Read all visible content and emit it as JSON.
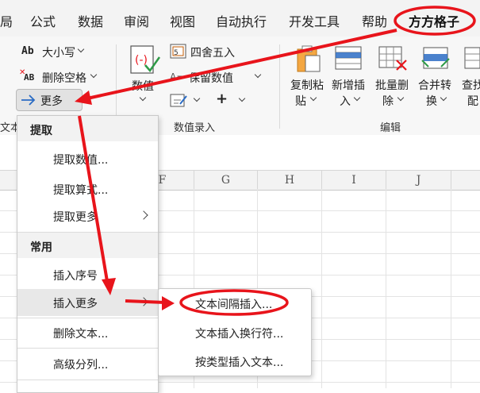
{
  "tabs": [
    "局",
    "公式",
    "数据",
    "审阅",
    "视图",
    "自动执行",
    "开发工具",
    "帮助",
    "方方格子"
  ],
  "ribbon": {
    "case_label": "大小写",
    "case_icon_text": "Ab",
    "delete_space_label": "删除空格",
    "delete_space_icon_text": "AB",
    "more_label": "更多",
    "text_group_label": "文本",
    "numeric_label": "数值",
    "round_label": "四舍五入",
    "keep_value_label": "保留数值",
    "keep_value_icon_text": "A=",
    "plus_label": "+",
    "numeric_group_label": "数值录入",
    "copy_paste_label_line1": "复制粘",
    "copy_paste_label_line2": "贴",
    "insert_label_line1": "新增插",
    "insert_label_line2": "入",
    "batch_delete_label_line1": "批量删",
    "batch_delete_label_line2": "除",
    "merge_label_line1": "合并转",
    "merge_label_line2": "换",
    "find_label_line1": "查找",
    "find_label_line2": "配",
    "edit_group_label": "编辑"
  },
  "columns": [
    "F",
    "G",
    "H",
    "I",
    "J"
  ],
  "menu": {
    "section_extract": "提取",
    "extract_items": [
      "提取数值...",
      "提取算式...",
      "提取更多"
    ],
    "section_common": "常用",
    "common_items": [
      "插入序号",
      "插入更多",
      "删除文本...",
      "高级分列..."
    ]
  },
  "submenu": {
    "items": [
      "文本间隔插入...",
      "文本插入换行符...",
      "按类型插入文本..."
    ]
  },
  "colors": {
    "annotation_red": "#e8141b",
    "accent_blue": "#2b6cc4",
    "icon_green": "#2e9a47"
  }
}
